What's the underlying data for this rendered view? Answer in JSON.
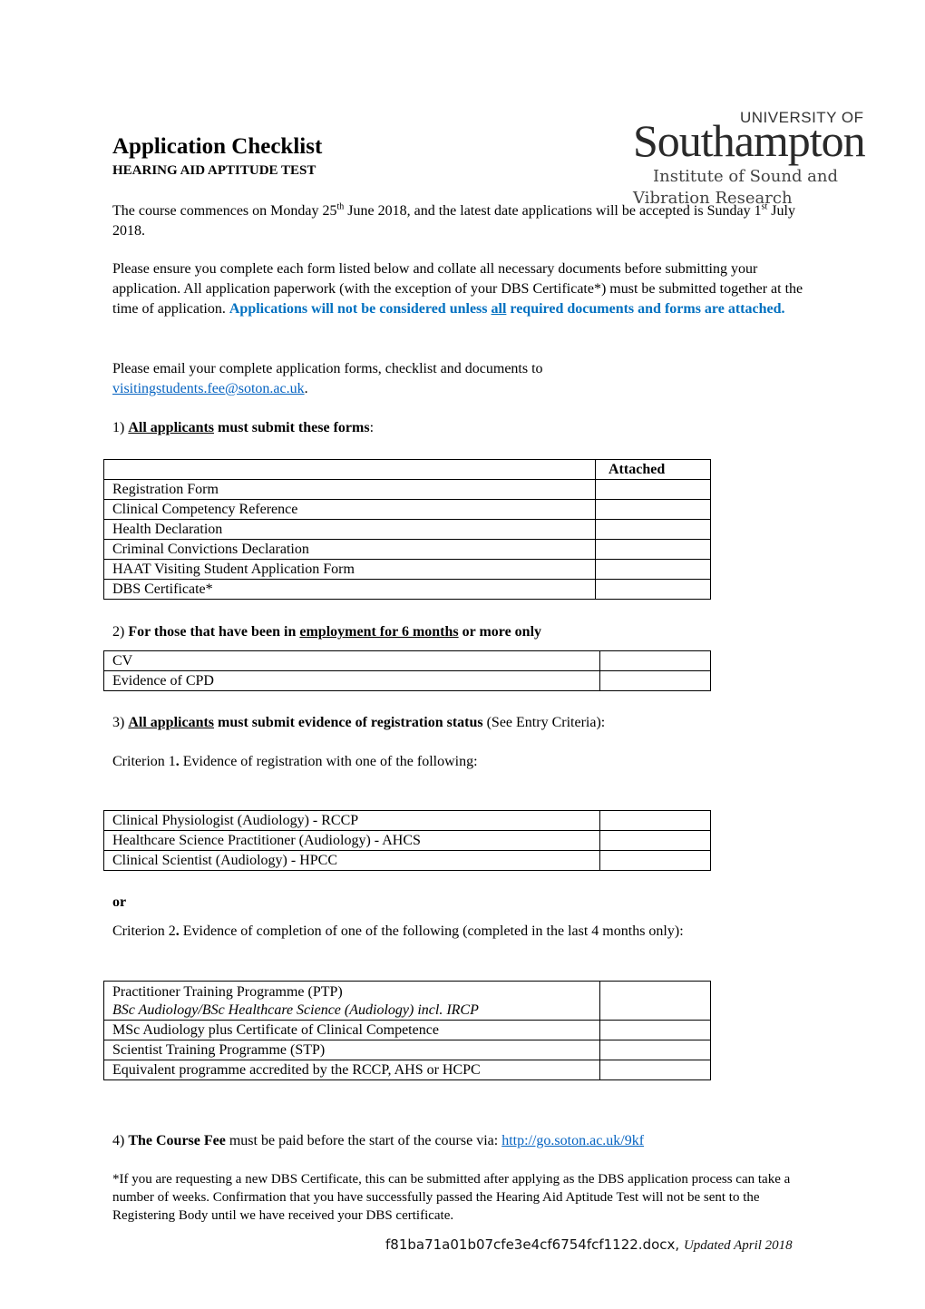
{
  "logo": {
    "line1": "UNIVERSITY OF",
    "line2": "Southampton",
    "line3": "Institute of Sound and",
    "line4": "Vibration Research"
  },
  "header": {
    "title": "Application Checklist",
    "subtitle": "HEARING AID APTITUDE TEST"
  },
  "intro": {
    "p1_a": "The course commences on Monday 25",
    "p1_sup1": "th",
    "p1_b": " June 2018, and the latest date applications will be accepted is Sunday 1",
    "p1_sup2": "st",
    "p1_c": " July 2018.",
    "p2_a": "Please ensure you complete each form listed below and collate all necessary documents before submitting your application. All application paperwork (with the exception of your DBS Certificate*) must be submitted together at the time of application. ",
    "p2_blue1": "Applications will not be considered unless ",
    "p2_blue_u": "all",
    "p2_blue2": " required documents and forms are attached.",
    "p3_a": "Please email your complete application forms, checklist and documents to ",
    "p3_email": "visitingstudents.fee@soton.ac.uk",
    "p3_b": "."
  },
  "section1": {
    "num": "1) ",
    "bold_u": "All applicants",
    "bold": " must submit these forms",
    "tail": ":",
    "table": {
      "header": "Attached",
      "rows": [
        "Registration Form",
        "Clinical Competency Reference",
        "Health Declaration",
        "Criminal Convictions Declaration",
        "HAAT Visiting Student Application Form",
        "DBS Certificate*"
      ]
    }
  },
  "section2": {
    "num": "2) ",
    "bold1": "For those that have been in ",
    "bold_u": "employment for 6 months",
    "bold2": " or more only",
    "rows": [
      "CV",
      "Evidence of CPD"
    ]
  },
  "section3": {
    "num": "3) ",
    "bold_u": "All applicants",
    "bold": " must submit evidence of registration status",
    "tail": " (See Entry Criteria):",
    "criterion1": {
      "label_a": "Criterion 1",
      "label_dot": ".",
      "label_b": " Evidence of registration with one of the following:",
      "rows": [
        "Clinical Physiologist (Audiology) - RCCP",
        "Healthcare Science Practitioner (Audiology) - AHCS",
        "Clinical Scientist (Audiology) - HPCC"
      ]
    },
    "or": "or",
    "criterion2": {
      "label_a": "Criterion 2",
      "label_dot": ".",
      "label_b": " Evidence of completion of one of the following (completed in the last 4 months only):",
      "row1_line1": "Practitioner Training Programme (PTP)",
      "row1_line2": "BSc Audiology/BSc Healthcare Science (Audiology) incl. IRCP",
      "rows": [
        "MSc Audiology plus Certificate of Clinical Competence",
        "Scientist Training Programme (STP)",
        "Equivalent programme accredited by the RCCP, AHS or HCPC"
      ]
    }
  },
  "section4": {
    "num": "4) ",
    "bold": "The Course Fee",
    "text": " must be paid before the start of the course via: ",
    "link": "http://go.soton.ac.uk/9kf"
  },
  "note": "*If you are requesting a new DBS Certificate, this can be submitted after applying as the DBS application process can take a number of weeks. Confirmation that you have successfully passed the Hearing Aid Aptitude Test will not be sent to the Registering Body until we have received your DBS certificate.",
  "footer": {
    "filename": "f81ba71a01b07cfe3e4cf6754fcf1122.docx",
    "sep": ", ",
    "updated": "Updated April 2018"
  }
}
